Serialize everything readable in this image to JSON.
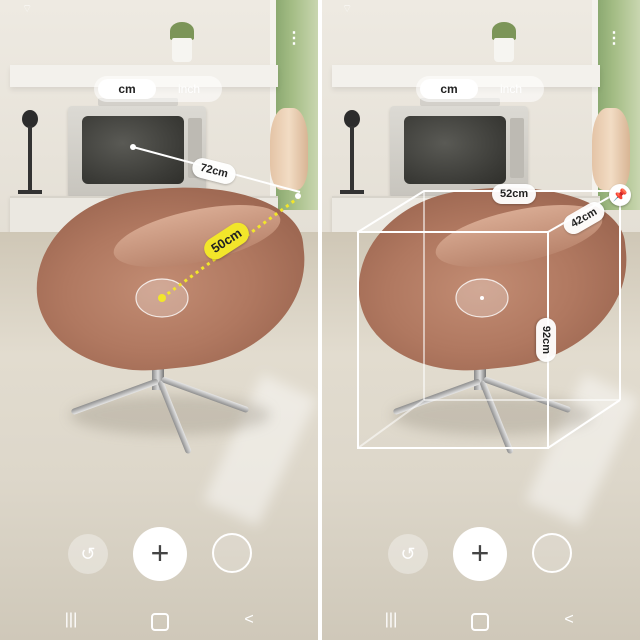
{
  "unit_toggle": {
    "options": [
      "cm",
      "inch"
    ],
    "selected": "cm"
  },
  "left_panel": {
    "measurements": {
      "distance_to_tv": "72cm",
      "chair_width": "50cm"
    }
  },
  "right_panel": {
    "measurements": {
      "width": "52cm",
      "depth": "42cm",
      "height": "92cm"
    }
  },
  "icons": {
    "wifi": "wifi-icon",
    "menu": "more-vertical-icon",
    "reset": "reset-icon",
    "add": "add-icon",
    "shape": "shape-circle-icon",
    "pin": "pin-icon",
    "nav_recent": "recent-apps-icon",
    "nav_home": "home-icon",
    "nav_back": "back-icon"
  },
  "glyphs": {
    "reset": "↺",
    "add": "+",
    "pin": "📌",
    "nav_recent": "|||",
    "nav_back": "<",
    "wifi": "⌔",
    "menu": "⋮"
  },
  "colors": {
    "measure_highlight": "#f2e62a",
    "overlay_white": "#ffffff"
  }
}
